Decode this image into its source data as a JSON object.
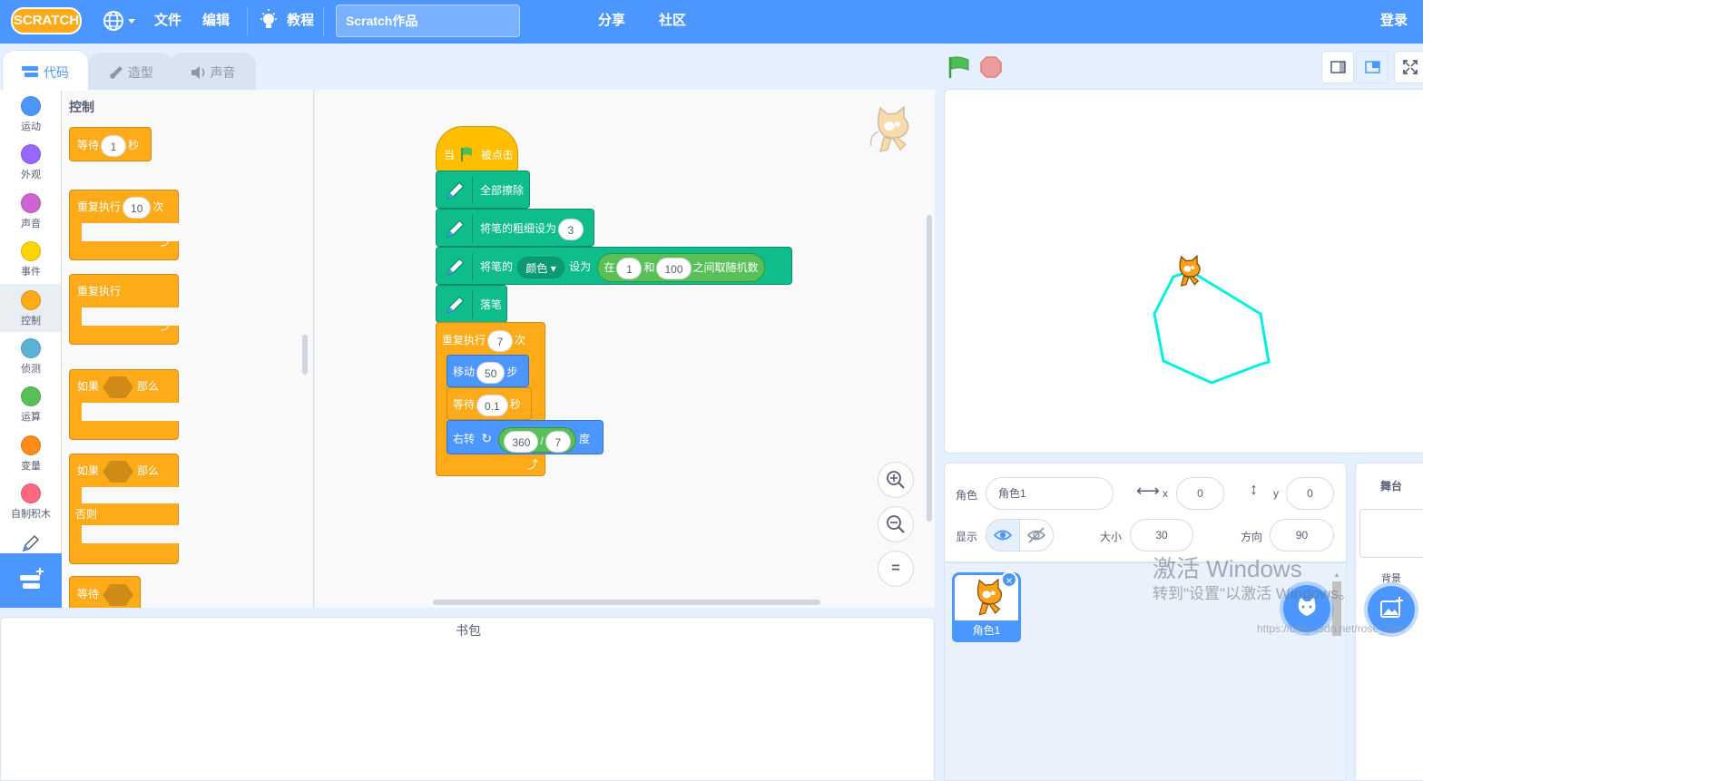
{
  "menubar": {
    "logo": "SCRATCH",
    "file": "文件",
    "edit": "编辑",
    "tutorials": "教程",
    "project_title": "Scratch作品",
    "share": "分享",
    "community": "社区",
    "login": "登录"
  },
  "tabs": {
    "code": "代码",
    "costumes": "造型",
    "sounds": "声音"
  },
  "categories": [
    {
      "label": "运动",
      "color": "#4c97ff"
    },
    {
      "label": "外观",
      "color": "#9966ff"
    },
    {
      "label": "声音",
      "color": "#cf63cf"
    },
    {
      "label": "事件",
      "color": "#ffd500"
    },
    {
      "label": "控制",
      "color": "#ffab19"
    },
    {
      "label": "侦测",
      "color": "#5cb1d6"
    },
    {
      "label": "运算",
      "color": "#59c059"
    },
    {
      "label": "变量",
      "color": "#ff8c1a"
    },
    {
      "label": "自制积木",
      "color": "#ff6680"
    }
  ],
  "flyout": {
    "heading": "控制",
    "wait": "等待",
    "wait_val": "1",
    "wait_unit": "秒",
    "repeat": "重复执行",
    "repeat_val": "10",
    "repeat_unit": "次",
    "forever": "重复执行",
    "if": "如果",
    "then": "那么",
    "if2": "如果",
    "then2": "那么",
    "else": "否则",
    "wait_until": "等待"
  },
  "script": {
    "when": "当",
    "clicked": "被点击",
    "clear": "全部擦除",
    "set_size": "将笔的粗细设为",
    "size_val": "3",
    "set_pen": "将笔的",
    "pen_param": "颜色",
    "set_to": "设为",
    "rand_in": "在",
    "rand_a": "1",
    "rand_and": "和",
    "rand_b": "100",
    "rand_suffix": "之间取随机数",
    "pen_down": "落笔",
    "repeat": "重复执行",
    "repeat_val": "7",
    "repeat_unit": "次",
    "move": "移动",
    "move_val": "50",
    "move_unit": "步",
    "wait": "等待",
    "wait_val": "0.1",
    "wait_unit": "秒",
    "turn": "右转",
    "div_a": "360",
    "div_op": "/",
    "div_b": "7",
    "turn_unit": "度"
  },
  "zoom": {
    "reset": "="
  },
  "sprite_info": {
    "sprite_label": "角色",
    "sprite_name": "角色1",
    "x_label": "x",
    "x_val": "0",
    "y_label": "y",
    "y_val": "0",
    "show_label": "显示",
    "size_label": "大小",
    "size_val": "30",
    "dir_label": "方向",
    "dir_val": "90"
  },
  "sprite_tile": {
    "name": "角色1"
  },
  "stage_panel": {
    "title": "舞台",
    "backdrops": "背景"
  },
  "backpack": "书包",
  "watermark": {
    "line1": "激活 Windows",
    "line2": "转到\"设置\"以激活 Windows。"
  },
  "url": "https://blog.csdn.net/rose_lwm",
  "colors": {
    "accent": "#4c97ff",
    "control": "#ffab19",
    "pen": "#0fbd8c",
    "drawing": "#00ffee"
  }
}
